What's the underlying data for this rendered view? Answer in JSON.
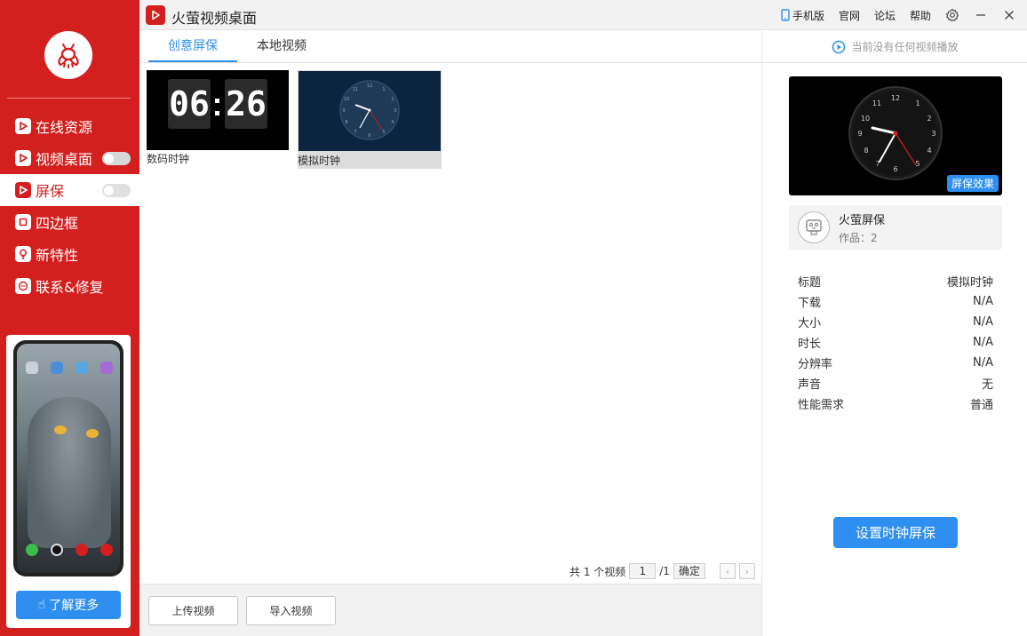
{
  "app": {
    "title": "火萤视频桌面"
  },
  "topbar": {
    "mobile": "手机版",
    "website": "官网",
    "forum": "论坛",
    "help": "帮助"
  },
  "sidebar": {
    "items": [
      {
        "label": "在线资源",
        "icon": "play-icon",
        "toggle": false
      },
      {
        "label": "视频桌面",
        "icon": "play-icon",
        "toggle": true,
        "toggle_on": false
      },
      {
        "label": "屏保",
        "icon": "play-icon",
        "toggle": true,
        "toggle_on": false,
        "active": true
      },
      {
        "label": "四边框",
        "icon": "frame-icon",
        "toggle": false
      },
      {
        "label": "新特性",
        "icon": "bulb-icon",
        "toggle": false
      },
      {
        "label": "联系&修复",
        "icon": "chat-icon",
        "toggle": false
      }
    ],
    "promo_button": "了解更多"
  },
  "tabs": [
    {
      "label": "创意屏保",
      "active": true
    },
    {
      "label": "本地视频",
      "active": false
    }
  ],
  "thumbnails": [
    {
      "caption": "数码时钟",
      "digits_left": "06",
      "digits_right": "26",
      "selected": false
    },
    {
      "caption": "模拟时钟",
      "selected": true
    }
  ],
  "pagination": {
    "total_prefix": "共 1 个视频",
    "page": "1",
    "of": "/1",
    "confirm": "确定"
  },
  "bottom": {
    "upload": "上传视频",
    "import": "导入视频"
  },
  "right": {
    "now_playing": "当前没有任何视频播放",
    "preview_badge": "屏保效果",
    "author_name": "火萤屏保",
    "author_works": "作品：2",
    "info": [
      {
        "key": "标题",
        "value": "模拟时钟"
      },
      {
        "key": "下载",
        "value": "N/A"
      },
      {
        "key": "大小",
        "value": "N/A"
      },
      {
        "key": "时长",
        "value": "N/A"
      },
      {
        "key": "分辨率",
        "value": "N/A"
      },
      {
        "key": "声音",
        "value": "无"
      },
      {
        "key": "性能需求",
        "value": "普通"
      }
    ],
    "set_button": "设置时钟屏保"
  },
  "colors": {
    "brand_red": "#d41f1f",
    "accent_blue": "#2f8ff0"
  }
}
